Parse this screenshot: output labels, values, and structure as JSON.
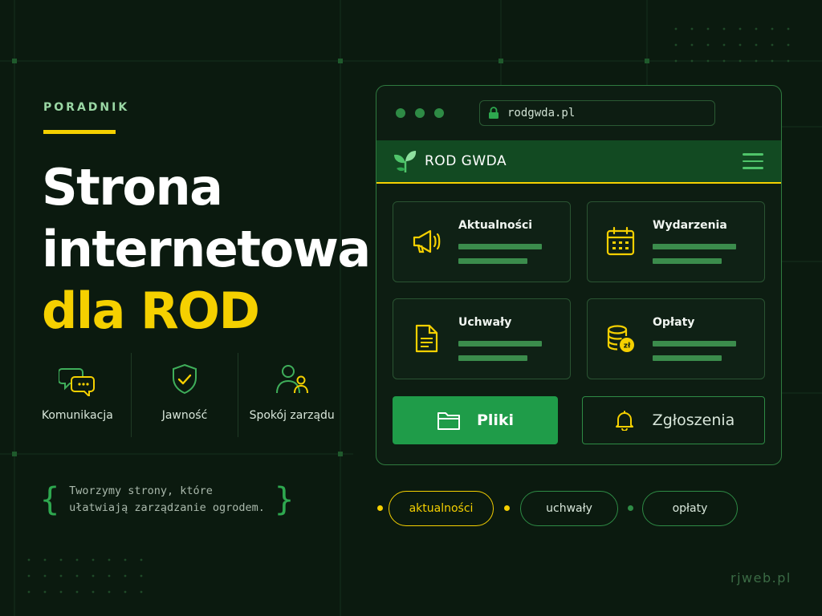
{
  "hero": {
    "eyebrow": "PORADNIK",
    "headline_line1": "Strona",
    "headline_line2": "internetowa",
    "headline_line3": "dla ROD"
  },
  "features": [
    {
      "label": "Komunikacja",
      "icon": "chat-bubbles-icon"
    },
    {
      "label": "Jawność",
      "icon": "shield-check-icon"
    },
    {
      "label": "Spokój zarządu",
      "icon": "users-icon"
    }
  ],
  "tagline": {
    "open_brace": "{",
    "line1": "Tworzymy strony, które",
    "line2": "ułatwiają zarządzanie ogrodem.",
    "close_brace": "}"
  },
  "browser": {
    "url": "rodgwda.pl",
    "site_name": "ROD GWDA",
    "cards": [
      {
        "title": "Aktualności",
        "icon": "megaphone-icon"
      },
      {
        "title": "Wydarzenia",
        "icon": "calendar-icon"
      },
      {
        "title": "Uchwały",
        "icon": "document-icon"
      },
      {
        "title": "Opłaty",
        "icon": "coins-icon"
      }
    ],
    "coin_badge": "zł",
    "primary_button": "Pliki",
    "secondary_button": "Zgłoszenia"
  },
  "tags": [
    {
      "label": "aktualności",
      "active": true
    },
    {
      "label": "uchwały",
      "active": false
    },
    {
      "label": "opłaty",
      "active": false
    }
  ],
  "brand": "rjweb.pl",
  "colors": {
    "background": "#0b1a0f",
    "accent_yellow": "#f5d000",
    "accent_green": "#1f9c49",
    "nav_green": "#124a22"
  }
}
